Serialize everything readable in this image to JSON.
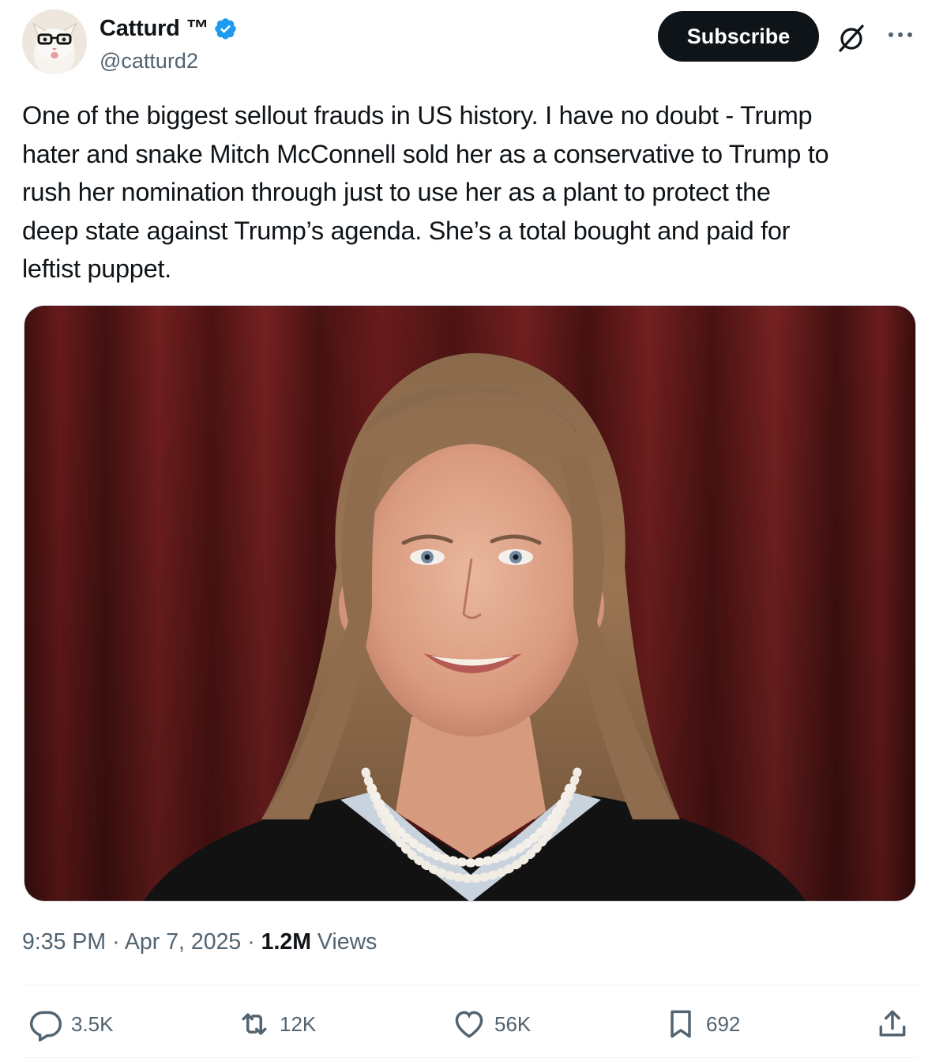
{
  "author": {
    "display_name": "Catturd ™",
    "handle": "@catturd2",
    "verified": true,
    "avatar_icon": "cat-with-glasses-avatar"
  },
  "header": {
    "subscribe_label": "Subscribe",
    "grok_icon": "grok-icon",
    "more_icon": "more-dots-icon"
  },
  "tweet": {
    "text": "One of the biggest sellout frauds in US history. I have no doubt - Trump\nhater and snake Mitch McConnell sold her as a conservative to Trump to\nrush her nomination through just to use her as a plant to protect the\ndeep state against Trump’s agenda. She’s a total bought and paid for\nleftist puppet."
  },
  "meta": {
    "time": "9:35 PM",
    "date": "Apr 7, 2025",
    "separator": "·",
    "views_count": "1.2M",
    "views_label": "Views"
  },
  "actions": {
    "replies": "3.5K",
    "reposts": "12K",
    "likes": "56K",
    "bookmarks": "692"
  },
  "colors": {
    "text_primary": "#0f1419",
    "text_secondary": "#536471",
    "verified_blue": "#1d9bf0",
    "subscribe_bg": "#0f1419",
    "curtain_red": "#7a1f1f"
  }
}
